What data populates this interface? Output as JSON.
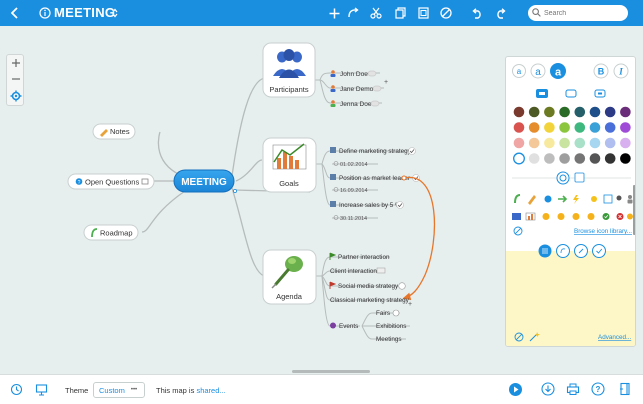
{
  "topbar": {
    "title": "MEETING",
    "search_placeholder": "Search"
  },
  "mindmap": {
    "central": "MEETING",
    "left_topics": [
      {
        "label": "Notes",
        "icon": "pencil-icon"
      },
      {
        "label": "Open Questions",
        "icon": "question-icon"
      },
      {
        "label": "Roadmap",
        "icon": "road-icon"
      }
    ],
    "participants": {
      "label": "Participants",
      "people": [
        "John Doe",
        "Jane Demo",
        "Jenna Doe"
      ]
    },
    "goals": {
      "label": "Goals",
      "items": [
        {
          "label": "Define marketing strategy",
          "date": "01.02.2014"
        },
        {
          "label": "Position as market leader",
          "date": "16.09.2014"
        },
        {
          "label": "Increase sales by 5 %",
          "date": "30.11.2014"
        }
      ]
    },
    "agenda": {
      "label": "Agenda",
      "items": [
        "Partner interaction",
        "Client interaction",
        "Social media strategy",
        "Classical marketing strategy",
        "Events"
      ],
      "events": [
        "Fairs",
        "Exhibitions",
        "Meetings"
      ]
    }
  },
  "panel": {
    "text_styles": [
      "a",
      "a",
      "a",
      "B",
      "I"
    ],
    "browse_label": "Browse icon library...",
    "advanced_label": "Advanced...",
    "colors": [
      "#7a3b2e",
      "#4e5a26",
      "#6c7a22",
      "#2a6b27",
      "#245f6a",
      "#1f4f8a",
      "#2d3a86",
      "#6a2d7a",
      "#d9534f",
      "#e58c2c",
      "#f2d43a",
      "#8cc63f",
      "#3fb87f",
      "#3aa0d8",
      "#4a6fd8",
      "#a04ad8",
      "#f0a6a4",
      "#f5c89a",
      "#f7ea9e",
      "#c8e4a0",
      "#a8e0c8",
      "#a6d6f0",
      "#b0bef0",
      "#d8b0f0",
      "#ffffff",
      "#e0e0e0",
      "#bdbdbd",
      "#9e9e9e",
      "#757575",
      "#555555",
      "#333333",
      "#000000"
    ]
  },
  "bottombar": {
    "theme_label": "Theme",
    "theme_value": "Custom",
    "theme_more": "•••",
    "shared_prefix": "This map is",
    "shared_link": "shared..."
  }
}
